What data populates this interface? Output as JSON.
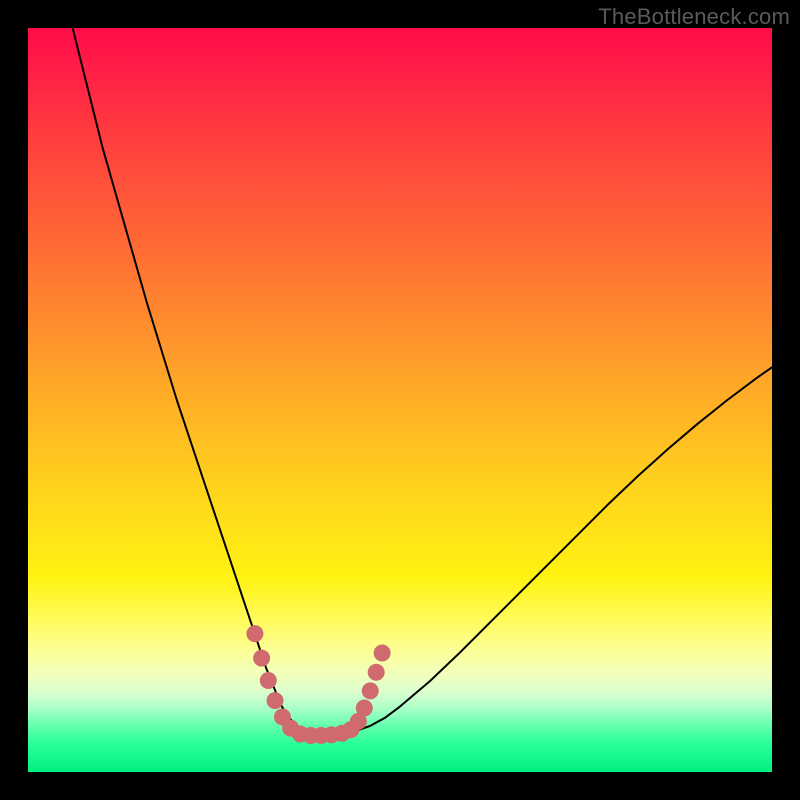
{
  "watermark": "TheBottleneck.com",
  "colors": {
    "background": "#000000",
    "curve_stroke": "#000000",
    "dot_fill": "#cf6b6f"
  },
  "chart_data": {
    "type": "line",
    "title": "",
    "xlabel": "",
    "ylabel": "",
    "xlim": [
      0,
      100
    ],
    "ylim": [
      0,
      100
    ],
    "grid": false,
    "legend": false,
    "series": [
      {
        "name": "bottleneck-curve",
        "x": [
          6,
          8,
          10,
          12,
          14,
          16,
          18,
          20,
          22,
          24,
          26,
          27,
          28,
          29,
          30,
          31,
          32,
          33,
          34,
          35,
          36,
          37,
          38,
          39,
          40,
          42,
          44,
          46,
          48,
          50,
          54,
          58,
          62,
          66,
          70,
          74,
          78,
          82,
          86,
          90,
          94,
          98,
          100
        ],
        "values": [
          100,
          92,
          84,
          77,
          70,
          63,
          56.5,
          50,
          44,
          38,
          32,
          29,
          26,
          23,
          20,
          17,
          14,
          11.5,
          9,
          7.4,
          6.3,
          5.6,
          5.2,
          5.0,
          5.0,
          5.1,
          5.5,
          6.2,
          7.3,
          8.8,
          12.2,
          16,
          20,
          24,
          28,
          32,
          36,
          39.8,
          43.4,
          46.8,
          50,
          53,
          54.4
        ]
      }
    ],
    "annotations": {
      "marker_points": [
        {
          "x": 30.5,
          "y": 18.6
        },
        {
          "x": 31.4,
          "y": 15.3
        },
        {
          "x": 32.3,
          "y": 12.3
        },
        {
          "x": 33.2,
          "y": 9.6
        },
        {
          "x": 34.2,
          "y": 7.4
        },
        {
          "x": 35.3,
          "y": 5.9
        },
        {
          "x": 36.6,
          "y": 5.1
        },
        {
          "x": 38.0,
          "y": 4.9
        },
        {
          "x": 39.4,
          "y": 4.9
        },
        {
          "x": 40.8,
          "y": 5.0
        },
        {
          "x": 42.2,
          "y": 5.2
        },
        {
          "x": 43.4,
          "y": 5.7
        },
        {
          "x": 44.4,
          "y": 6.8
        },
        {
          "x": 45.2,
          "y": 8.6
        },
        {
          "x": 46.0,
          "y": 10.9
        },
        {
          "x": 46.8,
          "y": 13.4
        },
        {
          "x": 47.6,
          "y": 16.0
        }
      ]
    }
  }
}
